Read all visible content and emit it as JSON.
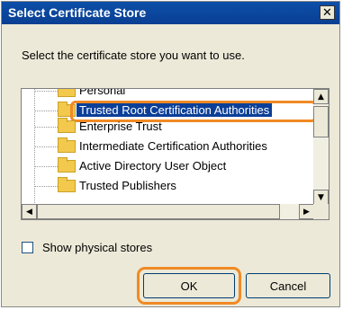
{
  "window": {
    "title": "Select Certificate Store"
  },
  "instruction": "Select the certificate store you want to use.",
  "store_list": {
    "items": [
      {
        "label": "Personal"
      },
      {
        "label": "Trusted Root Certification Authorities",
        "selected": true
      },
      {
        "label": "Enterprise Trust"
      },
      {
        "label": "Intermediate Certification Authorities"
      },
      {
        "label": "Active Directory User Object"
      },
      {
        "label": "Trusted Publishers"
      }
    ]
  },
  "show_physical": {
    "label": "Show physical stores",
    "checked": false
  },
  "buttons": {
    "ok": "OK",
    "cancel": "Cancel"
  },
  "colors": {
    "titlebar": "#0a3f93",
    "highlight": "#0b3f98",
    "callout": "#f08a24"
  },
  "icons": [
    "close-icon",
    "folder-icon",
    "scroll-up-icon",
    "scroll-down-icon",
    "scroll-left-icon",
    "scroll-right-icon"
  ]
}
